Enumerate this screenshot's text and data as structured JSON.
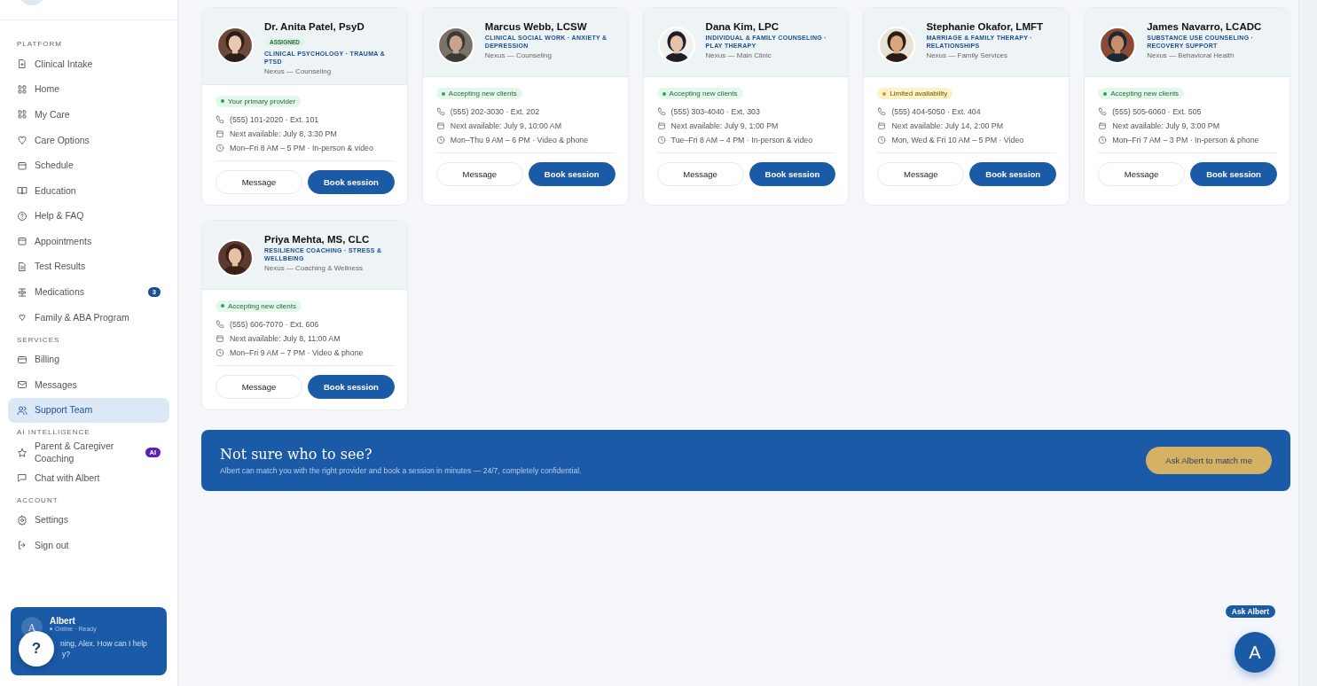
{
  "sidebar": {
    "sections": [
      {
        "label": "PLATFORM",
        "items": [
          {
            "label": "Clinical Intake",
            "selected": false
          },
          {
            "label": "Home",
            "selected": false
          },
          {
            "label": "My Care",
            "selected": false
          },
          {
            "label": "Care Options",
            "selected": false
          },
          {
            "label": "Schedule",
            "selected": false
          },
          {
            "label": "Education",
            "selected": false
          },
          {
            "label": "Help & FAQ",
            "selected": false
          },
          {
            "label": "Appointments",
            "selected": false
          },
          {
            "label": "Test Results",
            "selected": false
          },
          {
            "label": "Medications",
            "selected": false,
            "badge": {
              "text": "3",
              "color": "#1b4f93"
            }
          },
          {
            "label": "Family & ABA Program",
            "selected": false
          }
        ]
      },
      {
        "label": "SERVICES",
        "items": [
          {
            "label": "Billing",
            "selected": false
          },
          {
            "label": "Messages",
            "selected": false
          },
          {
            "label": "Support Team",
            "selected": true
          }
        ]
      },
      {
        "label": "AI INTELLIGENCE",
        "items": [
          {
            "label": "Parent & Caregiver Coaching",
            "selected": false,
            "badge": {
              "text": "AI",
              "color": "#5b21b6"
            }
          },
          {
            "label": "Chat with Albert",
            "selected": false
          }
        ]
      },
      {
        "label": "ACCOUNT",
        "items": [
          {
            "label": "Settings",
            "selected": false
          },
          {
            "label": "Sign out",
            "selected": false
          }
        ]
      }
    ],
    "assistant": {
      "avatar": "A",
      "name": "Albert",
      "status": "Online · Ready",
      "greeting_line_1": "ning, Alex. How can I help",
      "greeting_line_2": "y?",
      "help_button": "?"
    }
  },
  "providers": [
    {
      "name": "Dr. Anita Patel, PsyD",
      "badge": "ASSIGNED",
      "specialty": "CLINICAL PSYCHOLOGY · TRAUMA & PTSD",
      "org": "Nexus — Counseling",
      "status": {
        "kind": "primary",
        "label": "Your primary provider"
      },
      "phone": "(555) 101-2020 · Ext. 101",
      "next": "Next available: July 8, 3:30 PM",
      "hours": "Mon–Fri 8 AM – 5 PM · In-person & video",
      "message": "Message",
      "book": "Book session"
    },
    {
      "name": "Marcus Webb, LCSW",
      "specialty": "CLINICAL SOCIAL WORK · ANXIETY & DEPRESSION",
      "org": "Nexus — Counseling",
      "status": {
        "kind": "accepting",
        "label": "Accepting new clients"
      },
      "phone": "(555) 202-3030 · Ext. 202",
      "next": "Next available: July 9, 10:00 AM",
      "hours": "Mon–Thu 9 AM – 6 PM · Video & phone",
      "message": "Message",
      "book": "Book session"
    },
    {
      "name": "Dana Kim, LPC",
      "specialty": "INDIVIDUAL & FAMILY COUNSELING · PLAY THERAPY",
      "org": "Nexus — Main Clinic",
      "status": {
        "kind": "accepting",
        "label": "Accepting new clients"
      },
      "phone": "(555) 303-4040 · Ext. 303",
      "next": "Next available: July 9, 1:00 PM",
      "hours": "Tue–Fri 8 AM – 4 PM · In-person & video",
      "message": "Message",
      "book": "Book session"
    },
    {
      "name": "Stephanie Okafor, LMFT",
      "specialty": "MARRIAGE & FAMILY THERAPY · RELATIONSHIPS",
      "org": "Nexus — Family Services",
      "status": {
        "kind": "limited",
        "label": "Limited availability"
      },
      "phone": "(555) 404-5050 · Ext. 404",
      "next": "Next available: July 14, 2:00 PM",
      "hours": "Mon, Wed & Fri 10 AM – 5 PM · Video",
      "message": "Message",
      "book": "Book session"
    },
    {
      "name": "James Navarro, LCADC",
      "specialty": "SUBSTANCE USE COUNSELING · RECOVERY SUPPORT",
      "org": "Nexus — Behavioral Health",
      "status": {
        "kind": "accepting",
        "label": "Accepting new clients"
      },
      "phone": "(555) 505-6060 · Ext. 505",
      "next": "Next available: July 9, 3:00 PM",
      "hours": "Mon–Fri 7 AM – 3 PM · In-person & phone",
      "message": "Message",
      "book": "Book session"
    },
    {
      "name": "Priya Mehta, MS, CLC",
      "specialty": "RESILIENCE COACHING · STRESS & WELLBEING",
      "org": "Nexus — Coaching & Wellness",
      "status": {
        "kind": "accepting",
        "label": "Accepting new clients"
      },
      "phone": "(555) 606-7070 · Ext. 606",
      "next": "Next available: July 8, 11:00 AM",
      "hours": "Mon–Fri 9 AM – 7 PM · Video & phone",
      "message": "Message",
      "book": "Book session"
    }
  ],
  "banner": {
    "title": "Not sure who to see?",
    "text": "Albert can match you with the right provider and book a session in minutes — 24/7, completely confidential.",
    "button": "Ask Albert to match me"
  },
  "floating": {
    "label": "Ask Albert",
    "button": "A"
  }
}
